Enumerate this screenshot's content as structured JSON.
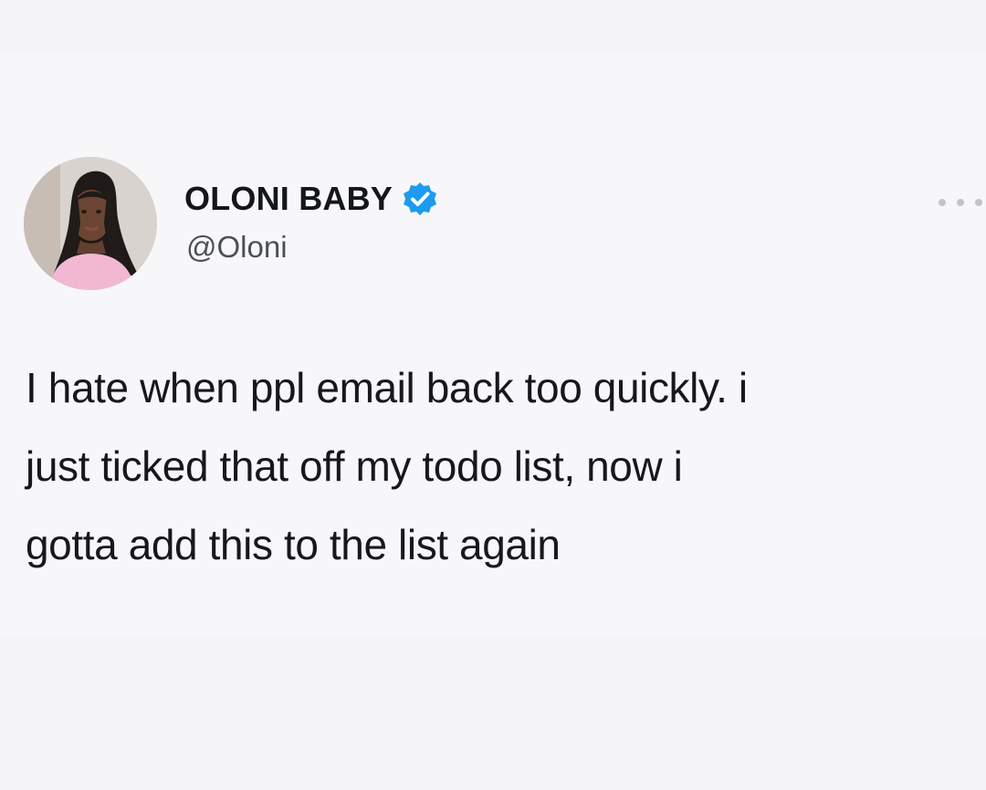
{
  "tweet": {
    "author": {
      "display_name": "OLONI BABY",
      "handle": "@Oloni",
      "verified": true,
      "avatar_icon": "profile-photo",
      "verified_icon": "verified-badge-icon"
    },
    "text_lines": [
      "I hate when ppl email back too quickly. i",
      "just ticked that off my todo list, now i",
      "gotta add this to the list again"
    ],
    "more_icon": "more-options-icon"
  },
  "colors": {
    "background": "#f4f3f6",
    "verified_blue": "#1d9bf0",
    "text": "#14171a",
    "muted_text": "#4c5056"
  }
}
